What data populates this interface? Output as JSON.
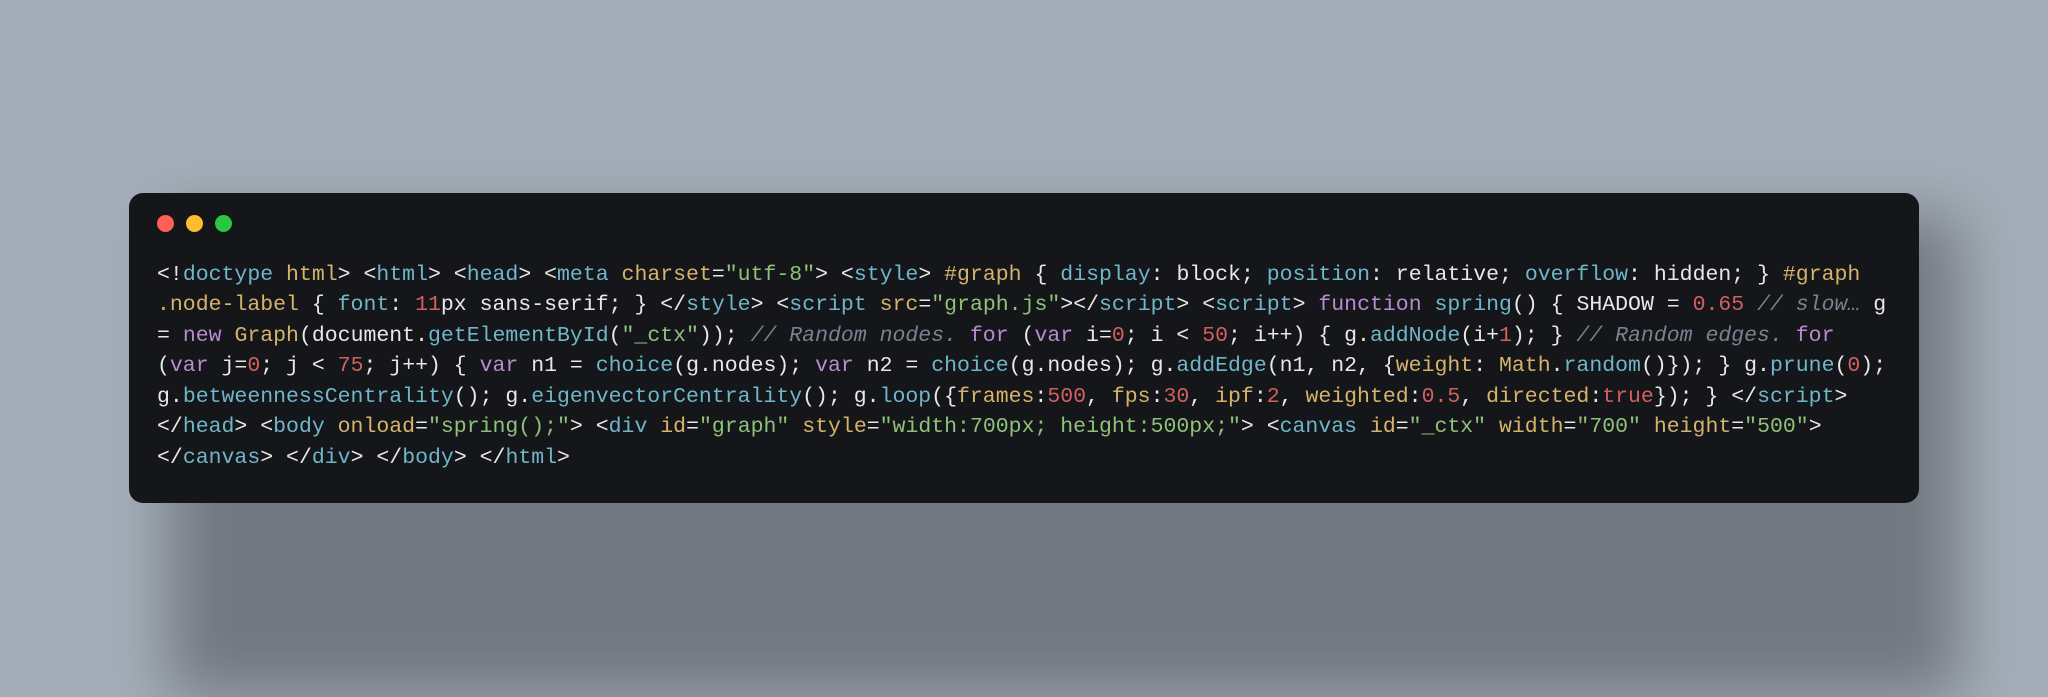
{
  "window": {
    "buttons": {
      "close_color": "#ff5f57",
      "minimize_color": "#febc2e",
      "zoom_color": "#28c840"
    }
  },
  "code": {
    "tokens": [
      {
        "t": "<!",
        "c": "c-punc"
      },
      {
        "t": "doctype",
        "c": "c-tag"
      },
      {
        "t": " ",
        "c": "c-default"
      },
      {
        "t": "html",
        "c": "c-attr"
      },
      {
        "t": ">",
        "c": "c-punc"
      },
      {
        "t": " ",
        "c": "c-default"
      },
      {
        "t": "<",
        "c": "c-punc"
      },
      {
        "t": "html",
        "c": "c-tag"
      },
      {
        "t": ">",
        "c": "c-punc"
      },
      {
        "t": " ",
        "c": "c-default"
      },
      {
        "t": "<",
        "c": "c-punc"
      },
      {
        "t": "head",
        "c": "c-tag"
      },
      {
        "t": ">",
        "c": "c-punc"
      },
      {
        "t": " ",
        "c": "c-default"
      },
      {
        "t": "<",
        "c": "c-punc"
      },
      {
        "t": "meta",
        "c": "c-tag"
      },
      {
        "t": " ",
        "c": "c-default"
      },
      {
        "t": "charset",
        "c": "c-attr"
      },
      {
        "t": "=",
        "c": "c-punc"
      },
      {
        "t": "\"utf-8\"",
        "c": "c-string"
      },
      {
        "t": ">",
        "c": "c-punc"
      },
      {
        "t": " ",
        "c": "c-default"
      },
      {
        "t": "<",
        "c": "c-punc"
      },
      {
        "t": "style",
        "c": "c-tag"
      },
      {
        "t": ">",
        "c": "c-punc"
      },
      {
        "t": " ",
        "c": "c-default"
      },
      {
        "t": "#graph",
        "c": "c-selector"
      },
      {
        "t": " { ",
        "c": "c-punc"
      },
      {
        "t": "display",
        "c": "c-prop"
      },
      {
        "t": ": ",
        "c": "c-punc"
      },
      {
        "t": "block",
        "c": "c-value"
      },
      {
        "t": "; ",
        "c": "c-punc"
      },
      {
        "t": "position",
        "c": "c-prop"
      },
      {
        "t": ": ",
        "c": "c-punc"
      },
      {
        "t": "relative",
        "c": "c-value"
      },
      {
        "t": "; ",
        "c": "c-punc"
      },
      {
        "t": "overflow",
        "c": "c-prop"
      },
      {
        "t": ": ",
        "c": "c-punc"
      },
      {
        "t": "hidden",
        "c": "c-value"
      },
      {
        "t": "; } ",
        "c": "c-punc"
      },
      {
        "t": "#graph .node-label",
        "c": "c-selector"
      },
      {
        "t": " { ",
        "c": "c-punc"
      },
      {
        "t": "font",
        "c": "c-prop"
      },
      {
        "t": ": ",
        "c": "c-punc"
      },
      {
        "t": "11",
        "c": "c-number"
      },
      {
        "t": "px",
        "c": "c-value"
      },
      {
        "t": " sans-serif",
        "c": "c-value"
      },
      {
        "t": "; } ",
        "c": "c-punc"
      },
      {
        "t": "</",
        "c": "c-punc"
      },
      {
        "t": "style",
        "c": "c-tag"
      },
      {
        "t": ">",
        "c": "c-punc"
      },
      {
        "t": " ",
        "c": "c-default"
      },
      {
        "t": "<",
        "c": "c-punc"
      },
      {
        "t": "script",
        "c": "c-tag"
      },
      {
        "t": " ",
        "c": "c-default"
      },
      {
        "t": "src",
        "c": "c-attr"
      },
      {
        "t": "=",
        "c": "c-punc"
      },
      {
        "t": "\"graph.js\"",
        "c": "c-string"
      },
      {
        "t": ">",
        "c": "c-punc"
      },
      {
        "t": "</",
        "c": "c-punc"
      },
      {
        "t": "script",
        "c": "c-tag"
      },
      {
        "t": ">",
        "c": "c-punc"
      },
      {
        "t": " ",
        "c": "c-default"
      },
      {
        "t": "<",
        "c": "c-punc"
      },
      {
        "t": "script",
        "c": "c-tag"
      },
      {
        "t": ">",
        "c": "c-punc"
      },
      {
        "t": " ",
        "c": "c-default"
      },
      {
        "t": "function",
        "c": "c-keyword"
      },
      {
        "t": " ",
        "c": "c-default"
      },
      {
        "t": "spring",
        "c": "c-func"
      },
      {
        "t": "() { ",
        "c": "c-punc"
      },
      {
        "t": "SHADOW",
        "c": "c-const"
      },
      {
        "t": " = ",
        "c": "c-punc"
      },
      {
        "t": "0.65",
        "c": "c-number"
      },
      {
        "t": " ",
        "c": "c-default"
      },
      {
        "t": "// slow…",
        "c": "c-comment"
      },
      {
        "t": " g = ",
        "c": "c-default"
      },
      {
        "t": "new",
        "c": "c-keyword"
      },
      {
        "t": " ",
        "c": "c-default"
      },
      {
        "t": "Graph",
        "c": "c-class"
      },
      {
        "t": "(",
        "c": "c-punc"
      },
      {
        "t": "document",
        "c": "c-ident"
      },
      {
        "t": ".",
        "c": "c-punc"
      },
      {
        "t": "getElementById",
        "c": "c-func"
      },
      {
        "t": "(",
        "c": "c-punc"
      },
      {
        "t": "\"_ctx\"",
        "c": "c-string"
      },
      {
        "t": ")); ",
        "c": "c-punc"
      },
      {
        "t": "// Random nodes.",
        "c": "c-comment"
      },
      {
        "t": " ",
        "c": "c-default"
      },
      {
        "t": "for",
        "c": "c-keyword"
      },
      {
        "t": " (",
        "c": "c-punc"
      },
      {
        "t": "var",
        "c": "c-keyword"
      },
      {
        "t": " i=",
        "c": "c-default"
      },
      {
        "t": "0",
        "c": "c-number"
      },
      {
        "t": "; i < ",
        "c": "c-default"
      },
      {
        "t": "50",
        "c": "c-number"
      },
      {
        "t": "; i++) { g.",
        "c": "c-default"
      },
      {
        "t": "addNode",
        "c": "c-func"
      },
      {
        "t": "(i+",
        "c": "c-default"
      },
      {
        "t": "1",
        "c": "c-number"
      },
      {
        "t": "); } ",
        "c": "c-default"
      },
      {
        "t": "// Random edges.",
        "c": "c-comment"
      },
      {
        "t": " ",
        "c": "c-default"
      },
      {
        "t": "for",
        "c": "c-keyword"
      },
      {
        "t": " (",
        "c": "c-punc"
      },
      {
        "t": "var",
        "c": "c-keyword"
      },
      {
        "t": " j=",
        "c": "c-default"
      },
      {
        "t": "0",
        "c": "c-number"
      },
      {
        "t": "; j < ",
        "c": "c-default"
      },
      {
        "t": "75",
        "c": "c-number"
      },
      {
        "t": "; j++) { ",
        "c": "c-default"
      },
      {
        "t": "var",
        "c": "c-keyword"
      },
      {
        "t": " n1 = ",
        "c": "c-default"
      },
      {
        "t": "choice",
        "c": "c-func"
      },
      {
        "t": "(g.nodes); ",
        "c": "c-default"
      },
      {
        "t": "var",
        "c": "c-keyword"
      },
      {
        "t": " n2 = ",
        "c": "c-default"
      },
      {
        "t": "choice",
        "c": "c-func"
      },
      {
        "t": "(g.nodes); g.",
        "c": "c-default"
      },
      {
        "t": "addEdge",
        "c": "c-func"
      },
      {
        "t": "(n1, n2, {",
        "c": "c-default"
      },
      {
        "t": "weight",
        "c": "c-attr"
      },
      {
        "t": ": ",
        "c": "c-punc"
      },
      {
        "t": "Math",
        "c": "c-class"
      },
      {
        "t": ".",
        "c": "c-punc"
      },
      {
        "t": "random",
        "c": "c-func"
      },
      {
        "t": "()}); } g.",
        "c": "c-default"
      },
      {
        "t": "prune",
        "c": "c-func"
      },
      {
        "t": "(",
        "c": "c-punc"
      },
      {
        "t": "0",
        "c": "c-number"
      },
      {
        "t": "); g.",
        "c": "c-default"
      },
      {
        "t": "betweennessCentrality",
        "c": "c-func"
      },
      {
        "t": "(); g.",
        "c": "c-default"
      },
      {
        "t": "eigenvectorCentrality",
        "c": "c-func"
      },
      {
        "t": "(); g.",
        "c": "c-default"
      },
      {
        "t": "loop",
        "c": "c-func"
      },
      {
        "t": "({",
        "c": "c-punc"
      },
      {
        "t": "frames",
        "c": "c-attr"
      },
      {
        "t": ":",
        "c": "c-punc"
      },
      {
        "t": "500",
        "c": "c-number"
      },
      {
        "t": ", ",
        "c": "c-punc"
      },
      {
        "t": "fps",
        "c": "c-attr"
      },
      {
        "t": ":",
        "c": "c-punc"
      },
      {
        "t": "30",
        "c": "c-number"
      },
      {
        "t": ", ",
        "c": "c-punc"
      },
      {
        "t": "ipf",
        "c": "c-attr"
      },
      {
        "t": ":",
        "c": "c-punc"
      },
      {
        "t": "2",
        "c": "c-number"
      },
      {
        "t": ", ",
        "c": "c-punc"
      },
      {
        "t": "weighted",
        "c": "c-attr"
      },
      {
        "t": ":",
        "c": "c-punc"
      },
      {
        "t": "0.5",
        "c": "c-number"
      },
      {
        "t": ", ",
        "c": "c-punc"
      },
      {
        "t": "directed",
        "c": "c-attr"
      },
      {
        "t": ":",
        "c": "c-punc"
      },
      {
        "t": "true",
        "c": "c-bool"
      },
      {
        "t": "}); } ",
        "c": "c-punc"
      },
      {
        "t": "</",
        "c": "c-punc"
      },
      {
        "t": "script",
        "c": "c-tag"
      },
      {
        "t": ">",
        "c": "c-punc"
      },
      {
        "t": " ",
        "c": "c-default"
      },
      {
        "t": "</",
        "c": "c-punc"
      },
      {
        "t": "head",
        "c": "c-tag"
      },
      {
        "t": ">",
        "c": "c-punc"
      },
      {
        "t": " ",
        "c": "c-default"
      },
      {
        "t": "<",
        "c": "c-punc"
      },
      {
        "t": "body",
        "c": "c-tag"
      },
      {
        "t": " ",
        "c": "c-default"
      },
      {
        "t": "onload",
        "c": "c-attr"
      },
      {
        "t": "=",
        "c": "c-punc"
      },
      {
        "t": "\"spring();\"",
        "c": "c-string"
      },
      {
        "t": ">",
        "c": "c-punc"
      },
      {
        "t": " ",
        "c": "c-default"
      },
      {
        "t": "<",
        "c": "c-punc"
      },
      {
        "t": "div",
        "c": "c-tag"
      },
      {
        "t": " ",
        "c": "c-default"
      },
      {
        "t": "id",
        "c": "c-attr"
      },
      {
        "t": "=",
        "c": "c-punc"
      },
      {
        "t": "\"graph\"",
        "c": "c-string"
      },
      {
        "t": " ",
        "c": "c-default"
      },
      {
        "t": "style",
        "c": "c-attr"
      },
      {
        "t": "=",
        "c": "c-punc"
      },
      {
        "t": "\"width:700px; height:500px;\"",
        "c": "c-string"
      },
      {
        "t": ">",
        "c": "c-punc"
      },
      {
        "t": " ",
        "c": "c-default"
      },
      {
        "t": "<",
        "c": "c-punc"
      },
      {
        "t": "canvas",
        "c": "c-tag"
      },
      {
        "t": " ",
        "c": "c-default"
      },
      {
        "t": "id",
        "c": "c-attr"
      },
      {
        "t": "=",
        "c": "c-punc"
      },
      {
        "t": "\"_ctx\"",
        "c": "c-string"
      },
      {
        "t": " ",
        "c": "c-default"
      },
      {
        "t": "width",
        "c": "c-attr"
      },
      {
        "t": "=",
        "c": "c-punc"
      },
      {
        "t": "\"700\"",
        "c": "c-string"
      },
      {
        "t": " ",
        "c": "c-default"
      },
      {
        "t": "height",
        "c": "c-attr"
      },
      {
        "t": "=",
        "c": "c-punc"
      },
      {
        "t": "\"500\"",
        "c": "c-string"
      },
      {
        "t": ">",
        "c": "c-punc"
      },
      {
        "t": "</",
        "c": "c-punc"
      },
      {
        "t": "canvas",
        "c": "c-tag"
      },
      {
        "t": ">",
        "c": "c-punc"
      },
      {
        "t": " ",
        "c": "c-default"
      },
      {
        "t": "</",
        "c": "c-punc"
      },
      {
        "t": "div",
        "c": "c-tag"
      },
      {
        "t": ">",
        "c": "c-punc"
      },
      {
        "t": " ",
        "c": "c-default"
      },
      {
        "t": "</",
        "c": "c-punc"
      },
      {
        "t": "body",
        "c": "c-tag"
      },
      {
        "t": ">",
        "c": "c-punc"
      },
      {
        "t": " ",
        "c": "c-default"
      },
      {
        "t": "</",
        "c": "c-punc"
      },
      {
        "t": "html",
        "c": "c-tag"
      },
      {
        "t": ">",
        "c": "c-punc"
      }
    ]
  }
}
